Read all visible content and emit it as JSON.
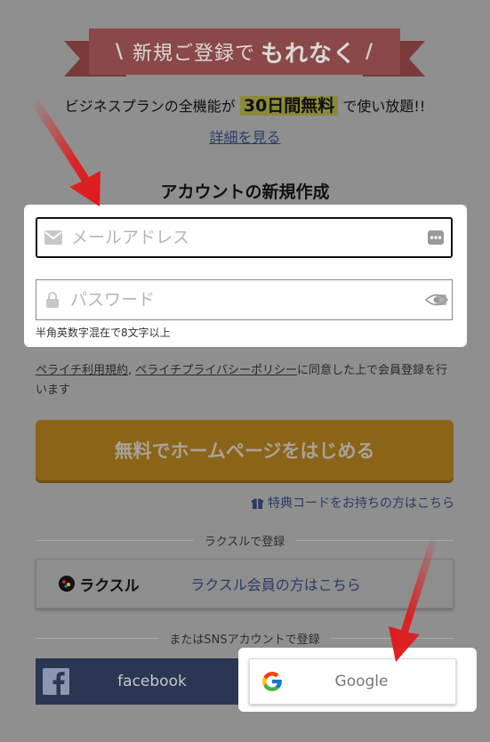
{
  "banner": {
    "prefix": "新規ご登録で",
    "emphasis": "もれなく",
    "slash_left": "\\",
    "slash_right": "/"
  },
  "lead": {
    "before": "ビジネスプランの全機能が",
    "highlight": "30日間無料",
    "after": "で使い放題!!"
  },
  "detail_link": "詳細を見る",
  "heading": "アカウントの新規作成",
  "form": {
    "email_placeholder": "メールアドレス",
    "password_placeholder": "パスワード",
    "password_hint": "半角英数字混在で8文字以上"
  },
  "terms": {
    "link1": "ペライチ利用規約",
    "sep": ", ",
    "link2": "ペライチプライバシーポリシー",
    "rest": "に同意した上で会員登録を行います"
  },
  "cta_label": "無料でホームページをはじめる",
  "promo_link": "特典コードをお持ちの方はこちら",
  "raksul": {
    "divider": "ラクスルで登録",
    "logo_text": "ラクスル",
    "label": "ラクスル会員の方はこちら"
  },
  "sns": {
    "divider": "またはSNSアカウントで登録",
    "facebook": "facebook",
    "google": "Google"
  },
  "icons": [
    "mail-icon",
    "lock-icon",
    "dots-icon",
    "eye-icon",
    "gift-icon",
    "facebook-icon",
    "google-icon",
    "raksul-logo"
  ],
  "colors": {
    "overlay": "#8f8f8f",
    "cta": "#8c6418",
    "facebook": "#2b3752",
    "arrow": "#e0191b"
  }
}
